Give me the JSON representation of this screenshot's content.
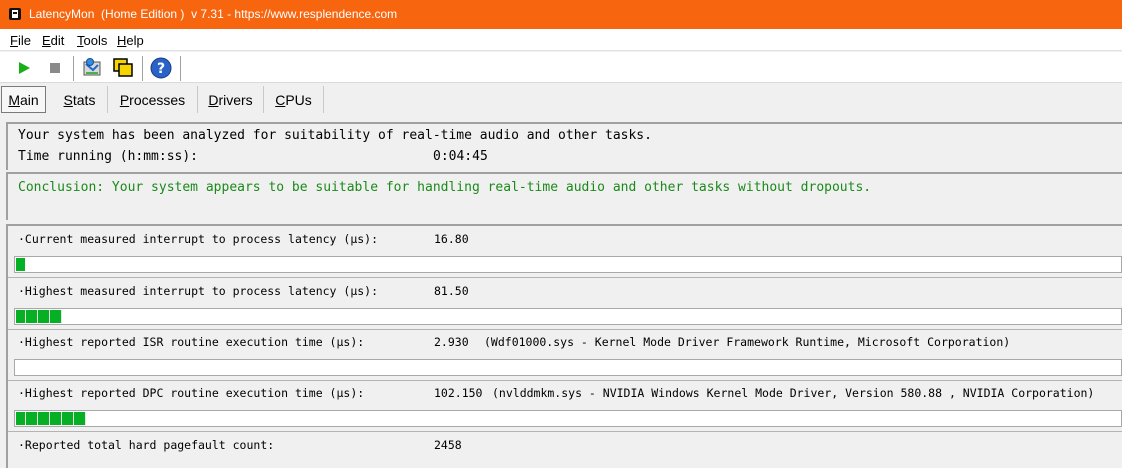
{
  "window": {
    "title": "LatencyMon  (Home Edition )  v 7.31 - https://www.resplendence.com",
    "accent": "#f7650f"
  },
  "menu": [
    {
      "first": "F",
      "rest": "ile"
    },
    {
      "first": "E",
      "rest": "dit"
    },
    {
      "first": "T",
      "rest": "ools"
    },
    {
      "first": "H",
      "rest": "elp"
    }
  ],
  "toolbar": {
    "icons": [
      "play-icon",
      "stop-icon",
      "report-icon",
      "windows-icon",
      "help-icon"
    ]
  },
  "tabs": [
    {
      "first": "M",
      "rest": "ain",
      "active": true
    },
    {
      "first": "S",
      "rest": "tats",
      "active": false
    },
    {
      "first": "P",
      "rest": "rocesses",
      "active": false
    },
    {
      "first": "D",
      "rest": "rivers",
      "active": false
    },
    {
      "first": "C",
      "rest": "PUs",
      "active": false
    }
  ],
  "summary": {
    "line1": "Your system has been analyzed for suitability of real-time audio and other tasks.",
    "time_label": "Time running (h:mm:ss):",
    "time_value": "0:04:45"
  },
  "conclusion": {
    "text": "Conclusion: Your system appears to be suitable for handling real-time audio and other tasks without dropouts.",
    "color": "#1a8a1a"
  },
  "metrics": [
    {
      "label": "·Current measured interrupt to process latency (µs):",
      "value": "16.80",
      "detail": "",
      "bar_fraction": 0.0085
    },
    {
      "label": "·Highest measured interrupt to process latency (µs):",
      "value": "81.50",
      "detail": "",
      "bar_fraction": 0.042
    },
    {
      "label": "·Highest reported ISR routine execution time (µs):",
      "value": "2.930",
      "detail": "(Wdf01000.sys - Kernel Mode Driver Framework Runtime, Microsoft Corporation)",
      "bar_fraction": 0.0
    },
    {
      "label": "·Highest reported DPC routine execution time (µs):",
      "value": "102.150",
      "detail": "(nvlddmkm.sys - NVIDIA Windows Kernel Mode Driver, Version 580.88 , NVIDIA Corporation)",
      "bar_fraction": 0.063
    },
    {
      "label": "·Reported total hard pagefault count:",
      "value": "2458",
      "detail": "",
      "bar_fraction": 0.0
    }
  ]
}
